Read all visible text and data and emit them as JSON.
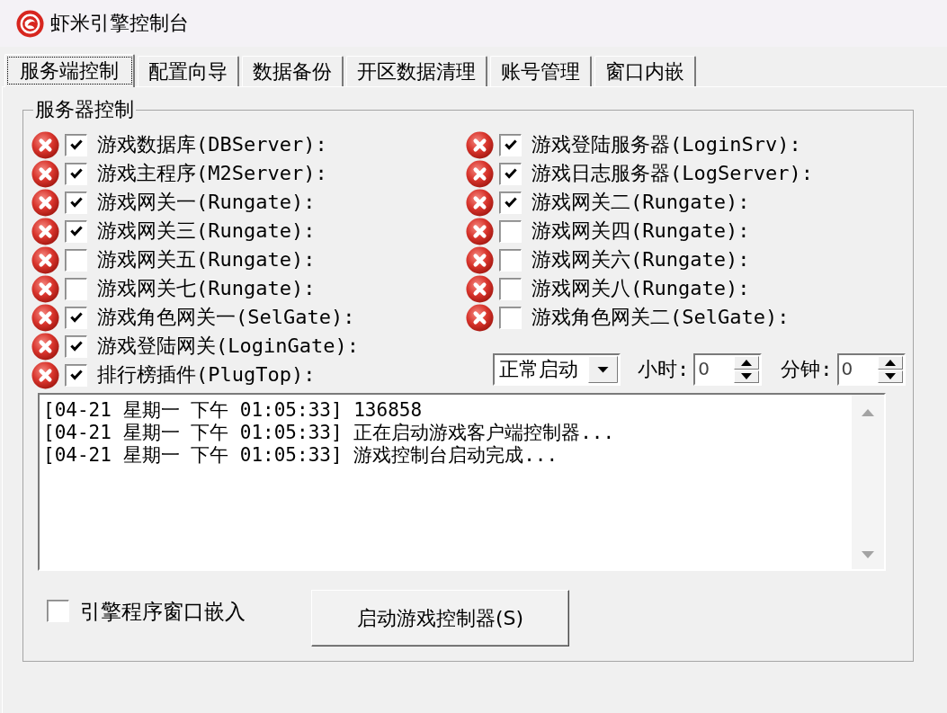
{
  "window": {
    "title": "虾米引擎控制台"
  },
  "tabs": [
    {
      "label": "服务端控制",
      "selected": true
    },
    {
      "label": "配置向导",
      "selected": false
    },
    {
      "label": "数据备份",
      "selected": false
    },
    {
      "label": "开区数据清理",
      "selected": false
    },
    {
      "label": "账号管理",
      "selected": false
    },
    {
      "label": "窗口内嵌",
      "selected": false
    }
  ],
  "server_control": {
    "title": "服务器控制",
    "servers_left": [
      {
        "label": "游戏数据库(DBServer):",
        "checked": true,
        "running": false
      },
      {
        "label": "游戏主程序(M2Server):",
        "checked": true,
        "running": false
      },
      {
        "label": "游戏网关一(Rungate):",
        "checked": true,
        "running": false
      },
      {
        "label": "游戏网关三(Rungate):",
        "checked": true,
        "running": false
      },
      {
        "label": "游戏网关五(Rungate):",
        "checked": false,
        "running": false
      },
      {
        "label": "游戏网关七(Rungate):",
        "checked": false,
        "running": false
      },
      {
        "label": "游戏角色网关一(SelGate):",
        "checked": true,
        "running": false
      },
      {
        "label": "游戏登陆网关(LoginGate):",
        "checked": true,
        "running": false
      },
      {
        "label": "排行榜插件(PlugTop):",
        "checked": true,
        "running": false
      }
    ],
    "servers_right": [
      {
        "label": "游戏登陆服务器(LoginSrv):",
        "checked": true,
        "running": false
      },
      {
        "label": "游戏日志服务器(LogServer):",
        "checked": true,
        "running": false
      },
      {
        "label": "游戏网关二(Rungate):",
        "checked": true,
        "running": false
      },
      {
        "label": "游戏网关四(Rungate):",
        "checked": false,
        "running": false
      },
      {
        "label": "游戏网关六(Rungate):",
        "checked": false,
        "running": false
      },
      {
        "label": "游戏网关八(Rungate):",
        "checked": false,
        "running": false
      },
      {
        "label": "游戏角色网关二(SelGate):",
        "checked": false,
        "running": false
      }
    ],
    "startup_mode": {
      "value": "正常启动"
    },
    "hour": {
      "label": "小时:",
      "value": "0"
    },
    "minute": {
      "label": "分钟:",
      "value": "0"
    },
    "log": {
      "lines": [
        "[04-21 星期一 下午 01:05:33] 136858",
        "[04-21 星期一 下午 01:05:33] 正在启动游戏客户端控制器...",
        "[04-21 星期一 下午 01:05:33] 游戏控制台启动完成..."
      ]
    },
    "embed_window": {
      "label": "引擎程序窗口嵌入",
      "checked": false
    },
    "start_button": {
      "label": "启动游戏控制器(S)"
    }
  }
}
